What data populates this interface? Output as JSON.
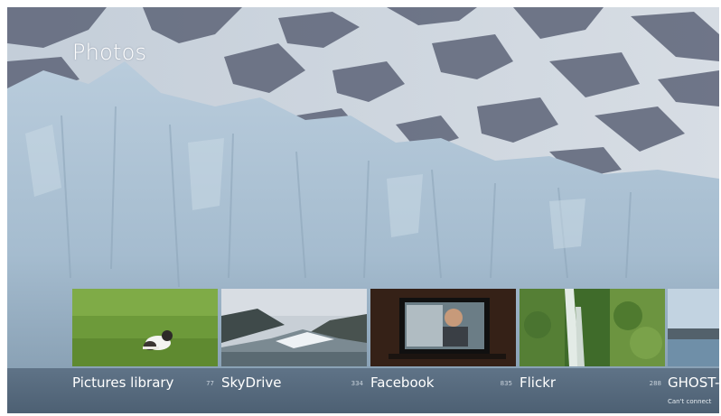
{
  "app": {
    "title": "Photos"
  },
  "tiles": [
    {
      "label": "Pictures library",
      "count": "77",
      "image": "pictures-library-thumbnail"
    },
    {
      "label": "SkyDrive",
      "count": "334",
      "image": "skydrive-thumbnail"
    },
    {
      "label": "Facebook",
      "count": "835",
      "image": "facebook-thumbnail"
    },
    {
      "label": "Flickr",
      "count": "288",
      "image": "flickr-thumbnail"
    },
    {
      "label": "GHOST-",
      "status": "Can't connect",
      "image": "ghost-thumbnail"
    }
  ],
  "colors": {
    "text": "#ffffff",
    "strip": "#566a7e"
  }
}
